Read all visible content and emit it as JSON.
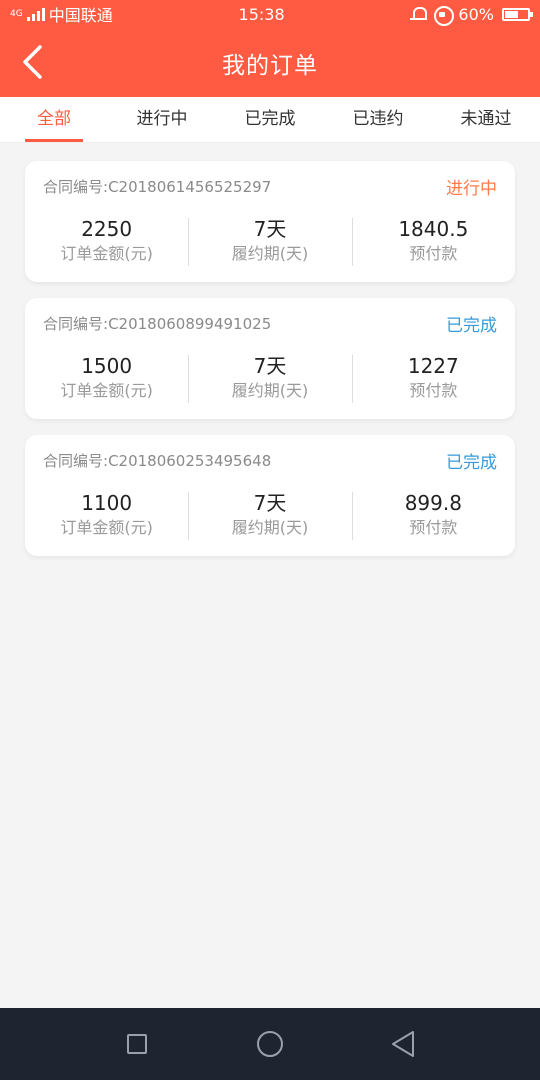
{
  "status_bar": {
    "network": "4G",
    "carrier": "中国联通",
    "time": "15:38",
    "battery": "60%",
    "battery_level": 0.6
  },
  "header": {
    "title": "我的订单",
    "back_icon": "chevron-left-icon"
  },
  "tabs": [
    {
      "label": "全部",
      "active": true
    },
    {
      "label": "进行中",
      "active": false
    },
    {
      "label": "已完成",
      "active": false
    },
    {
      "label": "已违约",
      "active": false
    },
    {
      "label": "未通过",
      "active": false
    }
  ],
  "orders": [
    {
      "contract_label": "合同编号:",
      "contract_no": "C2018061456525297",
      "status": "进行中",
      "status_type": "ongoing",
      "amount": "2250",
      "amount_label": "订单金额(元)",
      "period": "7天",
      "period_label": "履约期(天)",
      "prepay": "1840.5",
      "prepay_label": "预付款"
    },
    {
      "contract_label": "合同编号:",
      "contract_no": "C2018060899491025",
      "status": "已完成",
      "status_type": "done",
      "amount": "1500",
      "amount_label": "订单金额(元)",
      "period": "7天",
      "period_label": "履约期(天)",
      "prepay": "1227",
      "prepay_label": "预付款"
    },
    {
      "contract_label": "合同编号:",
      "contract_no": "C2018060253495648",
      "status": "已完成",
      "status_type": "done",
      "amount": "1100",
      "amount_label": "订单金额(元)",
      "period": "7天",
      "period_label": "履约期(天)",
      "prepay": "899.8",
      "prepay_label": "预付款"
    }
  ],
  "colors": {
    "brand": "#ff5a42",
    "status_ongoing": "#ff7a4a",
    "status_done": "#3a9ad9",
    "nav_bar": "#1e2430"
  },
  "nav_icons": [
    "square-icon",
    "circle-icon",
    "triangle-back-icon"
  ]
}
